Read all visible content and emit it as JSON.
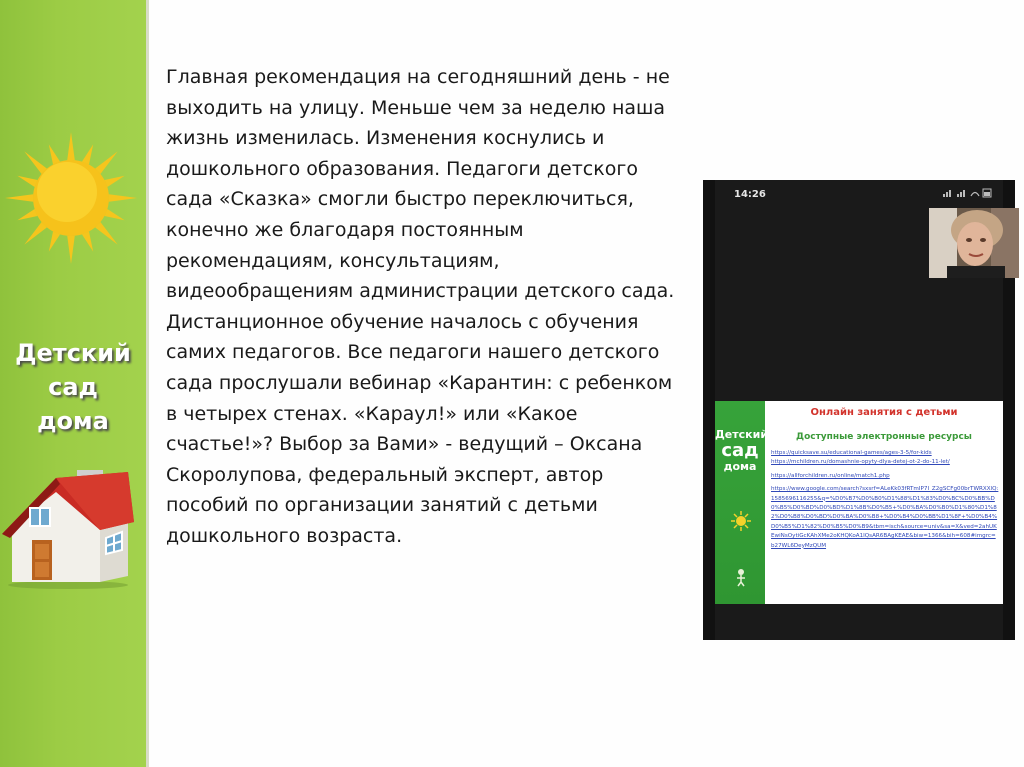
{
  "sidebar": {
    "title_lines": [
      "Детский",
      "сад",
      "дома"
    ],
    "sun_icon": "sun-icon",
    "house_icon": "house-icon",
    "background_color": "#9ccc45"
  },
  "body_text": "Главная рекомендация на сегодняшний день - не выходить на улицу.  Меньше чем за неделю наша жизнь изменилась. Изменения коснулись и дошкольного образования. Педагоги детского сада «Сказка» смогли быстро переключиться, конечно же благодаря постоянным рекомендациям, консультациям, видеообращениям администрации детского сада.  Дистанционное обучение началось с обучения самих педагогов. Все педагоги нашего детского сада прослушали вебинар «Карантин: с ребенком в четырех стенах. «Караул!» или «Какое счастье!»? Выбор за Вами» - ведущий – Оксана Скоролупова, федеральный эксперт, автор пособий по организации занятий с детьми дошкольного возраста.",
  "phone": {
    "status_time": "14:26",
    "card": {
      "logo_lines": [
        "Детский",
        "сад",
        "дома"
      ],
      "title": "Онлайн занятия с детьми",
      "subtitle": "Доступные электронные ресурсы",
      "links": [
        "https://quicksave.su/educational-games/ages-3-5/for-kids",
        "https://mchildren.ru/domashnie-opyty-dlya-detej-ot-2-do-11-let/",
        "https://allforchildren.ru/online/match1.php",
        "https://www.google.com/search?sxsrf=ALeKk03fRTmIP7I_Z2gSCFg00brTWRXXlQ:1585696116255&q=%D0%B7%D0%B0%D1%88%D1%83%D0%BC%D0%BB%D0%B5%D0%BD%D0%BD%D1%8B%D0%B5+%D0%BA%D0%B0%D1%80%D1%82%D0%B8%D0%BD%D0%BA%D0%B8+%D0%B4%D0%BB%D1%8F+%D0%B4%D0%B5%D1%82%D0%B5%D0%B9&tbm=isch&source=univ&sa=X&ved=2ahUKEwiNsOytiGcKAhXMe2oKHQKoA1IQsAR6BAgKEAE&biw=1366&bih=608#imgrc=b27WL6DeyMzQUM"
      ]
    }
  }
}
